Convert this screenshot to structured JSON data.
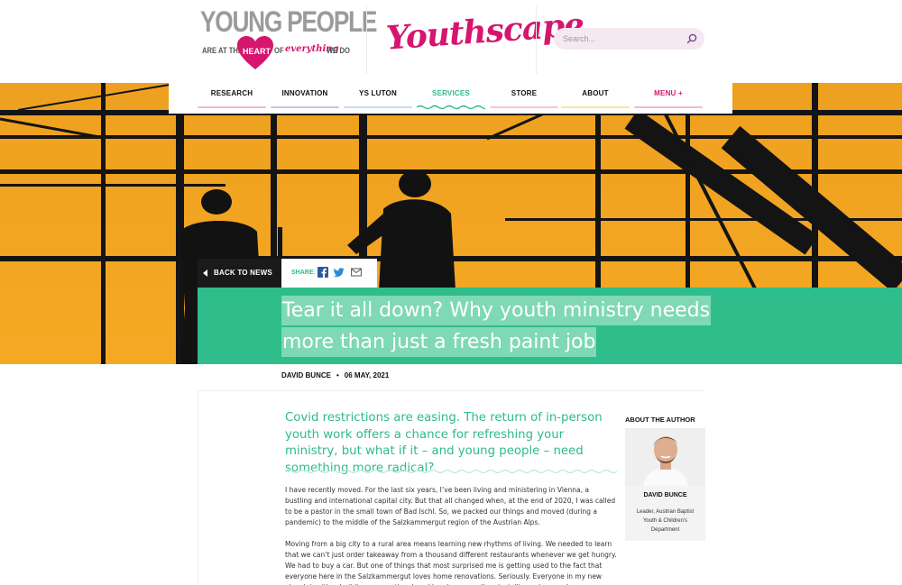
{
  "header": {
    "young_people_logo": {
      "title": "YOUNG PEOPLE",
      "tag_1": "ARE AT THE",
      "tag_heart": "HEART",
      "tag_of": "OF",
      "tag_everything": "everything",
      "tag_we_do": "WE DO"
    },
    "brand_logo": "Youthscape",
    "search": {
      "placeholder": "Search...",
      "icon": "search-icon"
    }
  },
  "nav": {
    "items": [
      {
        "label": "RESEARCH",
        "color": "#f3b9d3"
      },
      {
        "label": "INNOVATION",
        "color": "#c9c3ea"
      },
      {
        "label": "YS LUTON",
        "color": "#c6dcf3"
      },
      {
        "label": "SERVICES",
        "color": "#2ebb8a",
        "active": true
      },
      {
        "label": "STORE",
        "color": "#f6c7cf"
      },
      {
        "label": "ABOUT",
        "color": "#f3e6a6"
      },
      {
        "label": "MENU +",
        "color": "#f3b9d3"
      }
    ]
  },
  "article": {
    "back_label": "BACK TO NEWS",
    "share_label": "SHARE:",
    "share_icons": [
      "facebook-icon",
      "twitter-icon",
      "mail-icon"
    ],
    "title_line_1": "Tear it all down? Why youth ministry needs",
    "title_line_2": "more than just a fresh paint job",
    "author": "DAVID BUNCE",
    "date": "06 MAY, 2021",
    "lede": "Covid restrictions are easing. The return of in-person youth work offers a chance for refreshing your ministry, but what if it – and young people – need something more radical?",
    "paragraph_1": "I have recently moved. For the last six years, I’ve been living and ministering in Vienna, a bustling and international capital city. But that all changed when, at the end of 2020, I was called to be a pastor in the small town of Bad Ischl. So, we packed our things and moved (during a pandemic) to the middle of the Salzkammergut region of the Austrian Alps.",
    "paragraph_2": "Moving from a big city to a rural area means learning new rhythms of living. We needed to learn that we can’t just order takeaway from a thousand different restaurants whenever we get hungry. We had to buy a car. But one of things that most surprised me is getting used to the fact that everyone here in the Salzkammergut loves home renovations. Seriously. Everyone in my new church is either building, renovating, knocking down a wall, or installing solar panels."
  },
  "author_box": {
    "heading": "ABOUT THE AUTHOR",
    "name": "DAVID BUNCE",
    "role": "Leader, Austrian Baptist Youth & Children’s Department"
  },
  "colors": {
    "brand_pink": "#d6156f",
    "brand_green": "#2ebb8a",
    "title_band": "#2fbd8b",
    "hero_sky": "#f0a221"
  }
}
